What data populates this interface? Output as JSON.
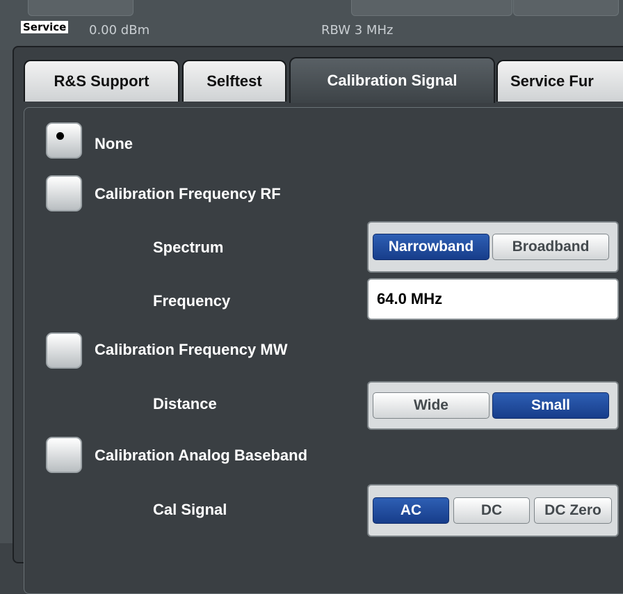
{
  "header": {
    "service_tag": "Service",
    "ref_level": "0.00 dBm",
    "rbw": "RBW 3 MHz"
  },
  "tabs": [
    {
      "label": "R&S Support",
      "active": false
    },
    {
      "label": "Selftest",
      "active": false
    },
    {
      "label": "Calibration Signal",
      "active": true
    },
    {
      "label": "Service Fur",
      "active": false
    }
  ],
  "options": {
    "none": {
      "label": "None",
      "selected": true
    },
    "cal_rf": {
      "label": "Calibration Frequency RF",
      "selected": false
    },
    "cal_mw": {
      "label": "Calibration Frequency MW",
      "selected": false
    },
    "cal_abb": {
      "label": "Calibration Analog Baseband",
      "selected": false
    }
  },
  "spectrum": {
    "label": "Spectrum",
    "options": [
      "Narrowband",
      "Broadband"
    ],
    "selected": "Narrowband"
  },
  "frequency": {
    "label": "Frequency",
    "value": "64.0 MHz"
  },
  "distance": {
    "label": "Distance",
    "options": [
      "Wide",
      "Small"
    ],
    "selected": "Small"
  },
  "cal_signal": {
    "label": "Cal Signal",
    "options": [
      "AC",
      "DC",
      "DC Zero"
    ],
    "selected": "AC"
  },
  "colors": {
    "accent_blue": "#1f4ea3",
    "panel_bg": "#3a3f43"
  }
}
